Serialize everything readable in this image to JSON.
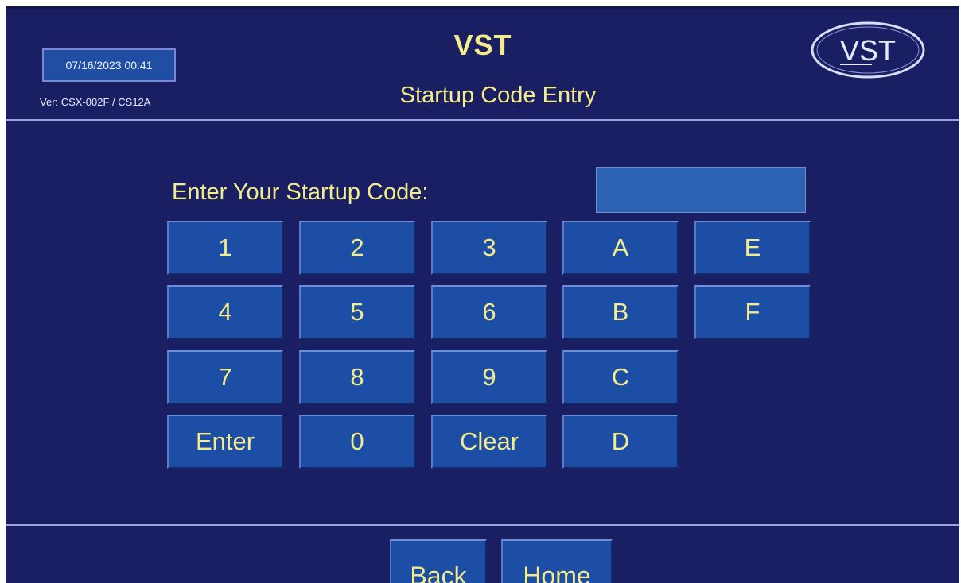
{
  "header": {
    "datetime": "07/16/2023 00:41",
    "version": "Ver: CSX-002F / CS12A",
    "app_title": "VST",
    "screen_title": "Startup Code Entry",
    "logo_text": "VST"
  },
  "entry": {
    "prompt": "Enter Your Startup Code:",
    "code_value": ""
  },
  "keypad": {
    "k1": "1",
    "k2": "2",
    "k3": "3",
    "kA": "A",
    "kE": "E",
    "k4": "4",
    "k5": "5",
    "k6": "6",
    "kB": "B",
    "kF": "F",
    "k7": "7",
    "k8": "8",
    "k9": "9",
    "kC": "C",
    "enter": "Enter",
    "k0": "0",
    "clear": "Clear",
    "kD": "D"
  },
  "nav": {
    "back": "Back",
    "home": "Home"
  },
  "colors": {
    "background": "#1a1f63",
    "button": "#1d4ea5",
    "text_yellow": "#f4eb8a",
    "input": "#2e63b4",
    "divider": "#9aa3d9"
  }
}
